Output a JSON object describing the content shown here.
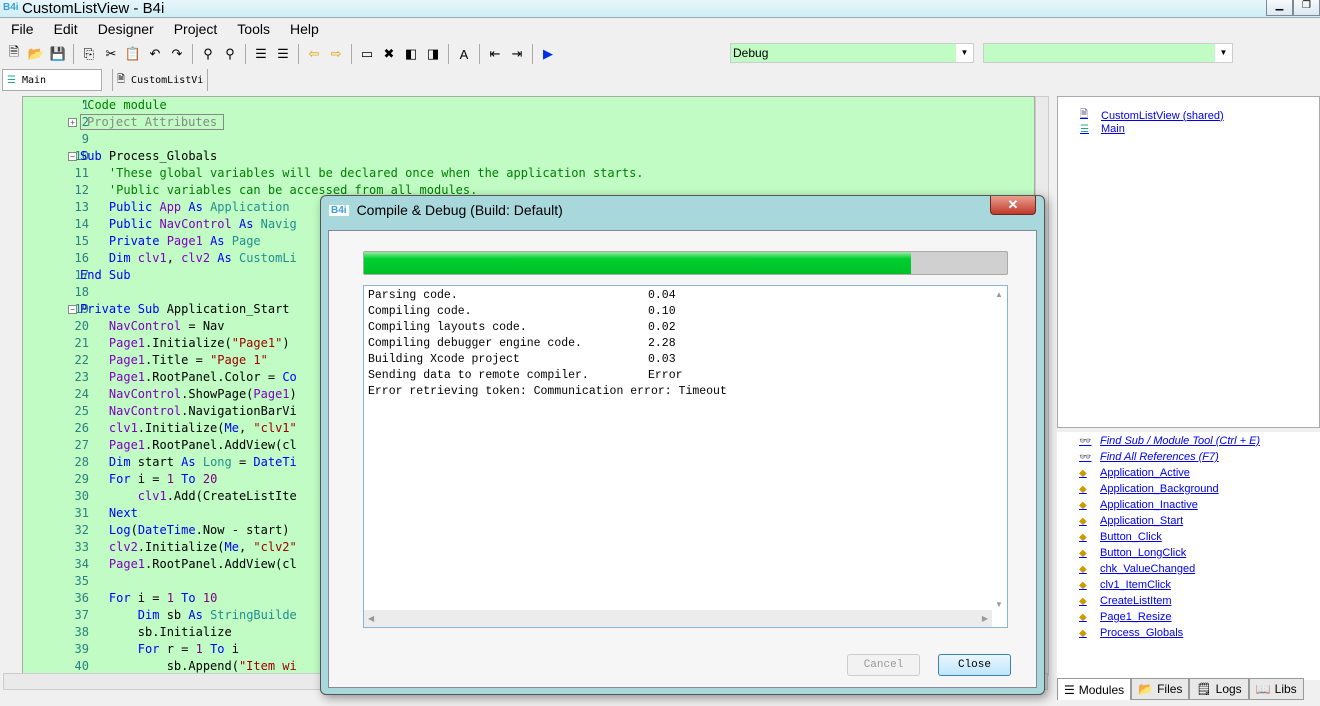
{
  "window": {
    "title": "CustomListView - B4i",
    "logo": "B4i"
  },
  "menu": [
    "File",
    "Edit",
    "Designer",
    "Project",
    "Tools",
    "Help"
  ],
  "toolbar": {
    "icons": [
      "new-file",
      "open",
      "save",
      "copy",
      "cut",
      "paste",
      "undo",
      "redo",
      "find",
      "find-add",
      "comment",
      "uncomment",
      "back",
      "forward",
      "bookmark",
      "clear-bookmarks",
      "prev-bookmark",
      "next-bookmark",
      "autoformat",
      "outdent",
      "indent",
      "run"
    ],
    "build_config": "Debug",
    "device": ""
  },
  "tabs": [
    {
      "label": "Main"
    },
    {
      "label": "CustomListVi"
    }
  ],
  "code": [
    {
      "n": "1",
      "t": [
        [
          "c",
          "'Code module"
        ]
      ]
    },
    {
      "n": "2",
      "fold": "+",
      "t": [
        [
          "attr",
          "Project Attributes"
        ]
      ]
    },
    {
      "n": "9",
      "t": []
    },
    {
      "n": "10",
      "fold": "-",
      "t": [
        [
          "k",
          "Sub "
        ],
        [
          "p",
          "Process_Globals"
        ]
      ]
    },
    {
      "n": "11",
      "t": [
        [
          "c",
          "    'These global variables will be declared once when the application starts."
        ]
      ]
    },
    {
      "n": "12",
      "t": [
        [
          "c",
          "    'Public variables can be accessed from all modules."
        ]
      ]
    },
    {
      "n": "13",
      "t": [
        [
          "k",
          "    Public "
        ],
        [
          "v",
          "App "
        ],
        [
          "k",
          "As "
        ],
        [
          "t",
          "Application"
        ]
      ]
    },
    {
      "n": "14",
      "t": [
        [
          "k",
          "    Public "
        ],
        [
          "v",
          "NavControl "
        ],
        [
          "k",
          "As "
        ],
        [
          "t",
          "Navig"
        ]
      ]
    },
    {
      "n": "15",
      "t": [
        [
          "k",
          "    Private "
        ],
        [
          "v",
          "Page1 "
        ],
        [
          "k",
          "As "
        ],
        [
          "t",
          "Page"
        ]
      ]
    },
    {
      "n": "16",
      "t": [
        [
          "k",
          "    Dim "
        ],
        [
          "v",
          "clv1"
        ],
        [
          "p",
          ", "
        ],
        [
          "v",
          "clv2 "
        ],
        [
          "k",
          "As "
        ],
        [
          "t",
          "CustomLi"
        ]
      ]
    },
    {
      "n": "17",
      "t": [
        [
          "k",
          "End Sub"
        ]
      ]
    },
    {
      "n": "18",
      "t": []
    },
    {
      "n": "19",
      "fold": "-",
      "t": [
        [
          "k",
          "Private Sub "
        ],
        [
          "p",
          "Application_Start"
        ]
      ]
    },
    {
      "n": "20",
      "t": [
        [
          "v",
          "    NavControl"
        ],
        [
          "p",
          " = Nav"
        ]
      ]
    },
    {
      "n": "21",
      "t": [
        [
          "v",
          "    Page1"
        ],
        [
          "p",
          ".Initialize("
        ],
        [
          "s",
          "\"Page1\""
        ],
        [
          "p",
          ")"
        ]
      ]
    },
    {
      "n": "22",
      "t": [
        [
          "v",
          "    Page1"
        ],
        [
          "p",
          ".Title = "
        ],
        [
          "s",
          "\"Page 1\""
        ]
      ]
    },
    {
      "n": "23",
      "t": [
        [
          "v",
          "    Page1"
        ],
        [
          "p",
          ".RootPanel.Color = "
        ],
        [
          "k",
          "Co"
        ]
      ]
    },
    {
      "n": "24",
      "t": [
        [
          "v",
          "    NavControl"
        ],
        [
          "p",
          ".ShowPage("
        ],
        [
          "v",
          "Page1"
        ],
        [
          "p",
          ")"
        ]
      ]
    },
    {
      "n": "25",
      "t": [
        [
          "v",
          "    NavControl"
        ],
        [
          "p",
          ".NavigationBarVi"
        ]
      ]
    },
    {
      "n": "26",
      "t": [
        [
          "v",
          "    clv1"
        ],
        [
          "p",
          ".Initialize("
        ],
        [
          "k",
          "Me"
        ],
        [
          "p",
          ", "
        ],
        [
          "s",
          "\"clv1\""
        ]
      ]
    },
    {
      "n": "27",
      "t": [
        [
          "v",
          "    Page1"
        ],
        [
          "p",
          ".RootPanel.AddView(cl"
        ]
      ]
    },
    {
      "n": "28",
      "t": [
        [
          "k",
          "    Dim "
        ],
        [
          "p",
          "start "
        ],
        [
          "k",
          "As "
        ],
        [
          "t",
          "Long "
        ],
        [
          "p",
          "= "
        ],
        [
          "k",
          "DateTi"
        ]
      ]
    },
    {
      "n": "29",
      "t": [
        [
          "k",
          "    For "
        ],
        [
          "p",
          "i = "
        ],
        [
          "n",
          "1 "
        ],
        [
          "k",
          "To "
        ],
        [
          "n",
          "20"
        ]
      ]
    },
    {
      "n": "30",
      "t": [
        [
          "v",
          "        clv1"
        ],
        [
          "p",
          ".Add(CreateListIte"
        ]
      ]
    },
    {
      "n": "31",
      "t": [
        [
          "k",
          "    Next"
        ]
      ]
    },
    {
      "n": "32",
      "t": [
        [
          "k",
          "    Log"
        ],
        [
          "p",
          "("
        ],
        [
          "k",
          "DateTime"
        ],
        [
          "p",
          ".Now - start)"
        ]
      ]
    },
    {
      "n": "33",
      "t": [
        [
          "v",
          "    clv2"
        ],
        [
          "p",
          ".Initialize("
        ],
        [
          "k",
          "Me"
        ],
        [
          "p",
          ", "
        ],
        [
          "s",
          "\"clv2\""
        ]
      ]
    },
    {
      "n": "34",
      "t": [
        [
          "v",
          "    Page1"
        ],
        [
          "p",
          ".RootPanel.AddView(cl"
        ]
      ]
    },
    {
      "n": "35",
      "t": []
    },
    {
      "n": "36",
      "t": [
        [
          "k",
          "    For "
        ],
        [
          "p",
          "i = "
        ],
        [
          "n",
          "1 "
        ],
        [
          "k",
          "To "
        ],
        [
          "n",
          "10"
        ]
      ]
    },
    {
      "n": "37",
      "t": [
        [
          "k",
          "        Dim "
        ],
        [
          "p",
          "sb "
        ],
        [
          "k",
          "As "
        ],
        [
          "t",
          "StringBuilde"
        ]
      ]
    },
    {
      "n": "38",
      "t": [
        [
          "p",
          "        sb.Initialize"
        ]
      ]
    },
    {
      "n": "39",
      "t": [
        [
          "k",
          "        For "
        ],
        [
          "p",
          "r = "
        ],
        [
          "n",
          "1 "
        ],
        [
          "k",
          "To "
        ],
        [
          "p",
          "i"
        ]
      ]
    },
    {
      "n": "40",
      "t": [
        [
          "p",
          "            sb.Append("
        ],
        [
          "s",
          "\"Item wi"
        ]
      ]
    }
  ],
  "modules": [
    {
      "label": "CustomListView (shared)",
      "icon": "document-icon"
    },
    {
      "label": "Main",
      "icon": "module-icon"
    }
  ],
  "subs": {
    "find_sub": "Find Sub / Module Tool (Ctrl + E)",
    "find_refs": "Find All References (F7)",
    "items": [
      "Application_Active",
      "Application_Background",
      "Application_Inactive",
      "Application_Start",
      "Button_Click",
      "Button_LongClick",
      "chk_ValueChanged",
      "clv1_ItemClick",
      "CreateListItem",
      "Page1_Resize",
      "Process_Globals"
    ]
  },
  "bottom_tabs": [
    "Modules",
    "Files",
    "Logs",
    "Libs"
  ],
  "dialog": {
    "title": "Compile & Debug (Build: Default)",
    "logo": "B4i",
    "progress_percent": 85,
    "log": [
      [
        "Parsing code.",
        "0.04"
      ],
      [
        "Compiling code.",
        "0.10"
      ],
      [
        "Compiling layouts code.",
        "0.02"
      ],
      [
        "Compiling debugger engine code.",
        "2.28"
      ],
      [
        "Building Xcode project",
        "0.03"
      ],
      [
        "Sending data to remote compiler.",
        "Error"
      ],
      [
        "Error retrieving token: Communication error: Timeout",
        ""
      ]
    ],
    "cancel": "Cancel",
    "close": "Close"
  },
  "colors": {
    "editor_bg": "#c0fcc4",
    "progress": "#00c830",
    "link": "#0000ee"
  }
}
